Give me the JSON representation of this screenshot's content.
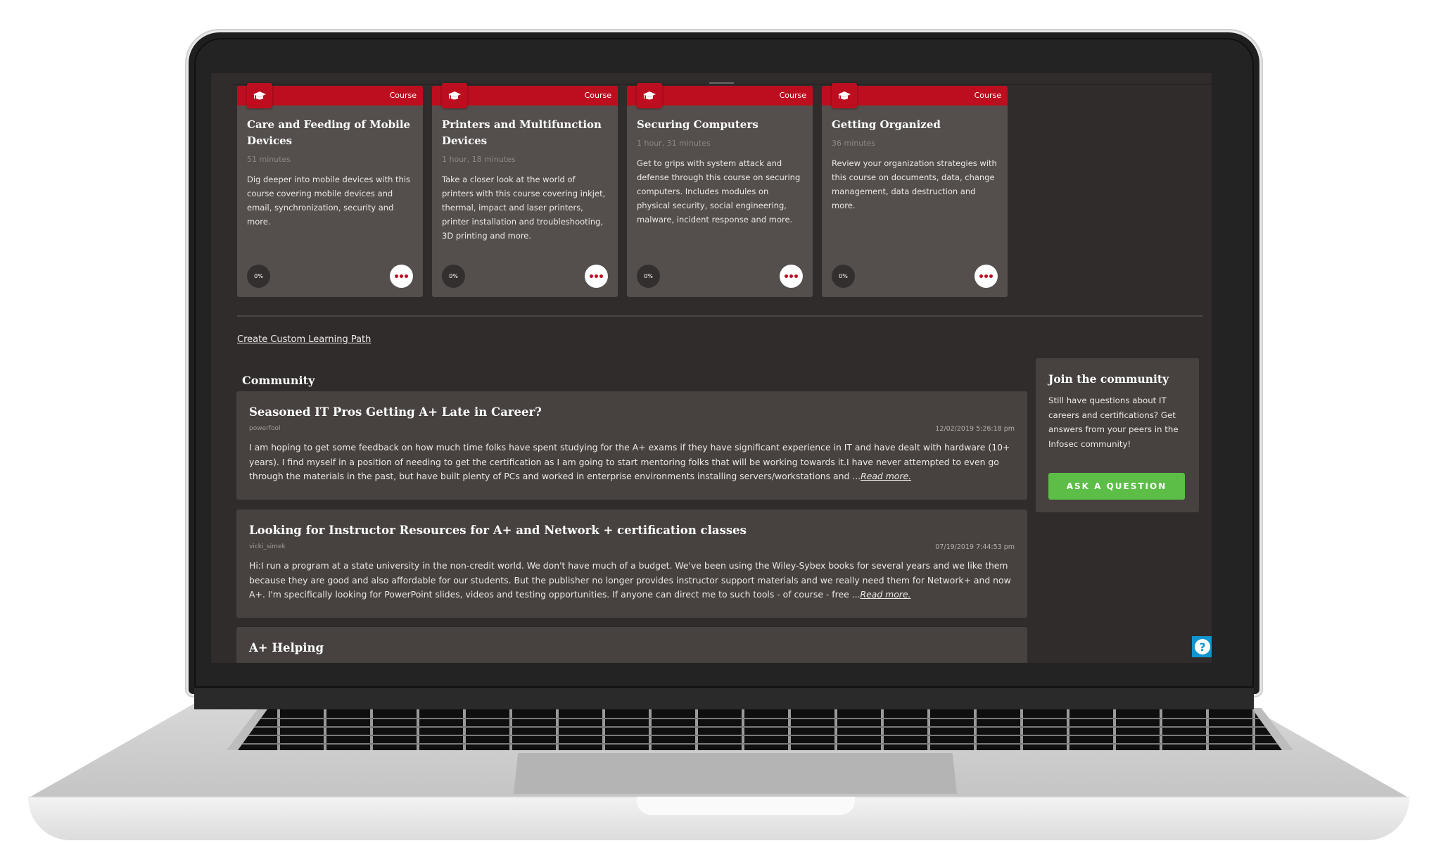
{
  "courses": [
    {
      "type": "Course",
      "icon": "graduation-cap-icon",
      "title": "Care and Feeding of Mobile Devices",
      "duration": "51 minutes",
      "description": "Dig deeper into mobile devices with this course covering mobile devices and email, synchronization, security and more.",
      "progress": "0%"
    },
    {
      "type": "Course",
      "icon": "graduation-cap-icon",
      "title": "Printers and Multifunction Devices",
      "duration": "1 hour, 18 minutes",
      "description": "Take a closer look at the world of printers with this course covering inkjet, thermal, impact and laser printers, printer installation and troubleshooting, 3D printing and more.",
      "progress": "0%"
    },
    {
      "type": "Course",
      "icon": "graduation-cap-icon",
      "title": "Securing Computers",
      "duration": "1 hour, 31 minutes",
      "description": "Get to grips with system attack and defense through this course on securing computers. Includes modules on physical security, social engineering, malware, incident response and more.",
      "progress": "0%"
    },
    {
      "type": "Course",
      "icon": "graduation-cap-icon",
      "title": "Getting Organized",
      "duration": "36 minutes",
      "description": "Review your organization strategies with this course on documents, data, change management, data destruction and more.",
      "progress": "0%"
    }
  ],
  "custom_path_link": "Create Custom Learning Path",
  "community": {
    "title": "Community",
    "posts": [
      {
        "title": "Seasoned IT Pros Getting A+ Late in Career?",
        "author": "powerfool",
        "date": "12/02/2019 5:26:18 pm",
        "body": "I am hoping to get some feedback on how much time folks have spent studying for the A+ exams if they have significant experience in IT and have dealt with hardware (10+ years).  I find myself in a position of needing to get the certification as I am going to start mentoring folks that will be working towards it.I have never attempted to even go through the materials in the past, but have built plenty of PCs and worked in enterprise environments installing servers/workstations and ...",
        "read_more": "Read more."
      },
      {
        "title": "Looking for Instructor Resources for A+ and Network + certification classes",
        "author": "vicki_simek",
        "date": "07/19/2019 7:44:53 pm",
        "body": "Hi:I run a program at a state university in the non-credit world.  We don't have much of a budget.  We've been using the Wiley-Sybex books for several years and we like them because they are good and also affordable for our students.  But the publisher no longer provides instructor support materials and we really need them for Network+ and now A+.  I'm specifically looking for PowerPoint slides, videos and testing opportunities.  If anyone can direct me to such tools - of course - free ...",
        "read_more": "Read more."
      },
      {
        "title": "A+ Helping"
      }
    ]
  },
  "join": {
    "title": "Join the community",
    "text": "Still have questions about IT careers and certifications? Get answers from your peers in the Infosec community!",
    "button": "ASK A QUESTION"
  },
  "help": {
    "icon": "question-icon",
    "label": "?"
  },
  "colors": {
    "brand_red": "#bd0e1f",
    "cta_green": "#5cbd47",
    "help_blue": "#1195d0",
    "page_bg": "#302c2b",
    "card_bg": "#544f4d"
  }
}
